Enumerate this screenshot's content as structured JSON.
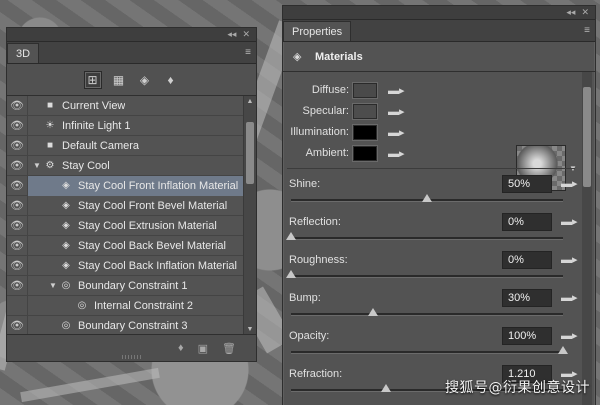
{
  "panel_3d": {
    "tab_label": "3D",
    "collapse_glyph": "◂◂",
    "close_glyph": "✕",
    "menu_glyph": "≡",
    "filters": [
      {
        "name": "scene-filter-icon",
        "glyph": "⊞",
        "active": true
      },
      {
        "name": "mesh-filter-icon",
        "glyph": "▦",
        "active": false
      },
      {
        "name": "material-filter-icon",
        "glyph": "◈",
        "active": false
      },
      {
        "name": "light-filter-icon",
        "glyph": "♦",
        "active": false
      }
    ],
    "tree": [
      {
        "label": "Current View",
        "icon": "camera-icon",
        "glyph": "■",
        "indent": 0,
        "twisty": "",
        "eye": true,
        "selected": false
      },
      {
        "label": "Infinite Light 1",
        "icon": "sun-icon",
        "glyph": "☀",
        "indent": 0,
        "twisty": "",
        "eye": true,
        "selected": false
      },
      {
        "label": "Default Camera",
        "icon": "camera-icon",
        "glyph": "■",
        "indent": 0,
        "twisty": "",
        "eye": true,
        "selected": false
      },
      {
        "label": "Stay  Cool",
        "icon": "text-layer-icon",
        "glyph": "⚙",
        "indent": 0,
        "twisty": "▼",
        "eye": true,
        "selected": false
      },
      {
        "label": "Stay  Cool Front Inflation Material",
        "icon": "material-icon",
        "glyph": "◈",
        "indent": 1,
        "twisty": "",
        "eye": true,
        "selected": true
      },
      {
        "label": "Stay  Cool Front Bevel Material",
        "icon": "material-icon",
        "glyph": "◈",
        "indent": 1,
        "twisty": "",
        "eye": true,
        "selected": false
      },
      {
        "label": "Stay  Cool Extrusion Material",
        "icon": "material-icon",
        "glyph": "◈",
        "indent": 1,
        "twisty": "",
        "eye": true,
        "selected": false
      },
      {
        "label": "Stay  Cool Back Bevel Material",
        "icon": "material-icon",
        "glyph": "◈",
        "indent": 1,
        "twisty": "",
        "eye": true,
        "selected": false
      },
      {
        "label": "Stay  Cool Back Inflation Material",
        "icon": "material-icon",
        "glyph": "◈",
        "indent": 1,
        "twisty": "",
        "eye": true,
        "selected": false
      },
      {
        "label": "Boundary Constraint 1",
        "icon": "constraint-icon",
        "glyph": "◎",
        "indent": 1,
        "twisty": "▼",
        "eye": true,
        "selected": false
      },
      {
        "label": "Internal Constraint 2",
        "icon": "constraint-icon",
        "glyph": "◎",
        "indent": 2,
        "twisty": "",
        "eye": false,
        "selected": false
      },
      {
        "label": "Boundary Constraint 3",
        "icon": "constraint-icon",
        "glyph": "◎",
        "indent": 1,
        "twisty": "",
        "eye": true,
        "selected": false
      }
    ],
    "footer": [
      {
        "name": "add-light-icon",
        "glyph": "♦"
      },
      {
        "name": "render-icon",
        "glyph": "▣"
      },
      {
        "name": "trash-icon",
        "glyph": "🗑"
      }
    ]
  },
  "panel_props": {
    "tab_label": "Properties",
    "collapse_glyph": "◂◂",
    "close_glyph": "✕",
    "menu_glyph": "≡",
    "header_title": "Materials",
    "textures": [
      {
        "label": "Diffuse:",
        "color": "#4a4a4a"
      },
      {
        "label": "Specular:",
        "color": "#4d4d4d"
      },
      {
        "label": "Illumination:",
        "color": "#000000"
      },
      {
        "label": "Ambient:",
        "color": "#000000"
      }
    ],
    "sliders": [
      {
        "label": "Shine:",
        "value": "50%",
        "level": 0.5
      },
      {
        "label": "Reflection:",
        "value": "0%",
        "level": 0.0
      },
      {
        "label": "Roughness:",
        "value": "0%",
        "level": 0.0
      },
      {
        "label": "Bump:",
        "value": "30%",
        "level": 0.3
      },
      {
        "label": "Opacity:",
        "value": "100%",
        "level": 1.0
      },
      {
        "label": "Refraction:",
        "value": "1.210",
        "level": 0.35
      }
    ]
  },
  "watermark": "搜狐号@衍果创意设计"
}
